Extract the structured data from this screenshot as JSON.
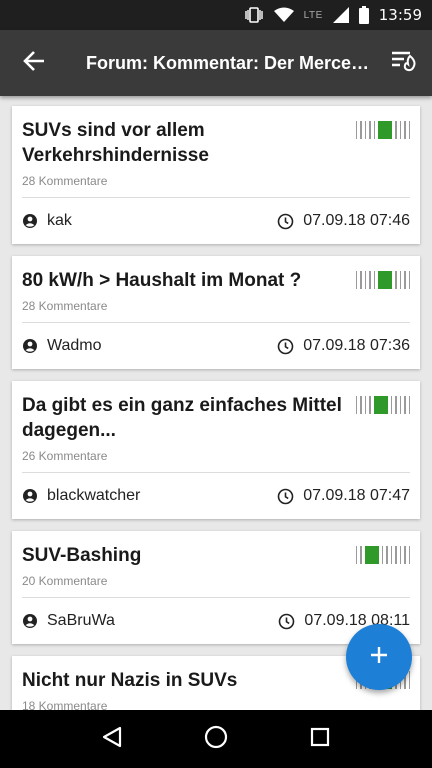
{
  "status_bar": {
    "network": "LTE",
    "time": "13:59"
  },
  "app_bar": {
    "title": "Forum: Kommentar: Der Merce…"
  },
  "threads": [
    {
      "title": "SUVs sind vor allem Verkehrshindernisse",
      "comments": "28 Kommentare",
      "author": "kak",
      "datetime": "07.09.18 07:46",
      "rating_fill": 0.55
    },
    {
      "title": "80 kW/h > Haushalt im Monat ?",
      "comments": "28 Kommentare",
      "author": "Wadmo",
      "datetime": "07.09.18 07:36",
      "rating_fill": 0.55
    },
    {
      "title": "Da gibt es ein ganz einfaches Mittel dagegen...",
      "comments": "26 Kommentare",
      "author": "blackwatcher",
      "datetime": "07.09.18 07:47",
      "rating_fill": 0.45
    },
    {
      "title": "SUV-Bashing",
      "comments": "20 Kommentare",
      "author": "SaBruWa",
      "datetime": "07.09.18 08:11",
      "rating_fill": 0.2
    },
    {
      "title": "Nicht nur Nazis in SUVs",
      "comments": "18 Kommentare",
      "author": "",
      "datetime": "",
      "rating_fill": 0.5
    }
  ],
  "icons": {
    "back": "arrow-left-icon",
    "action": "filter-fire-icon",
    "author": "user-icon",
    "time": "clock-icon",
    "fab": "plus-icon"
  },
  "colors": {
    "accent": "#1e7fd6",
    "rating": "#2f9a2a",
    "appbar": "#3a3a3a"
  }
}
